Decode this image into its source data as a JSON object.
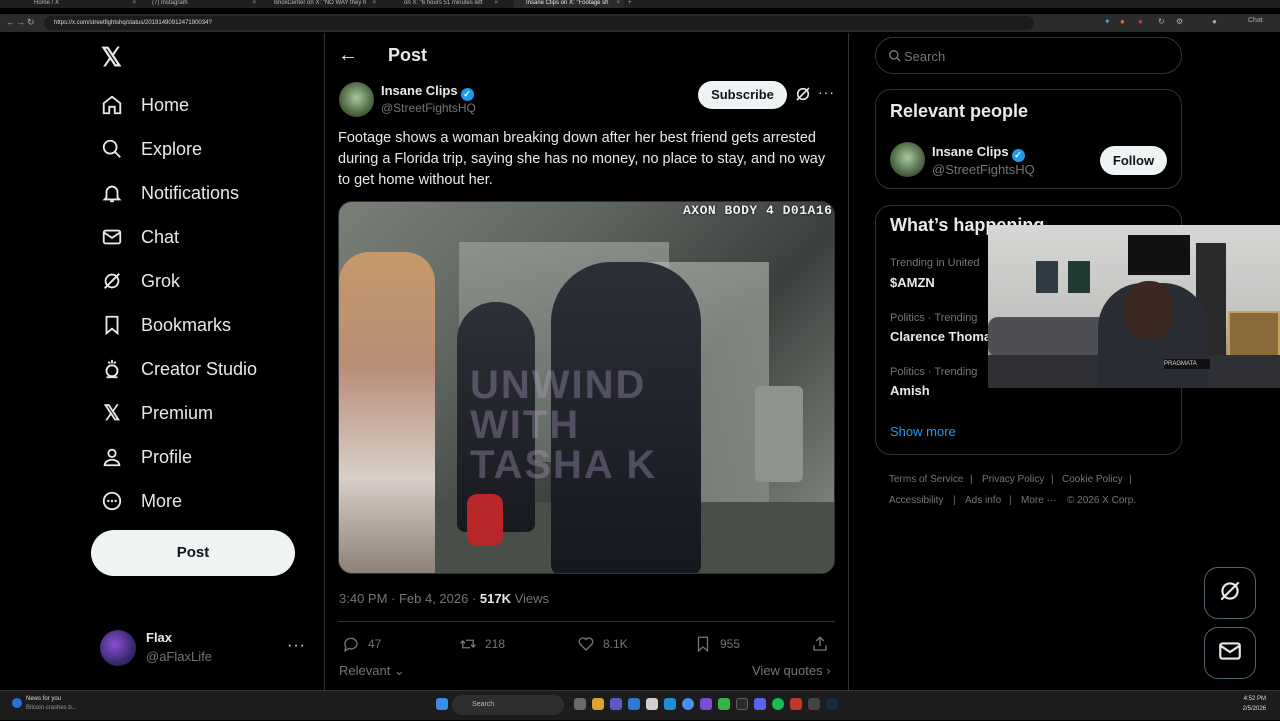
{
  "browser": {
    "tabs": [
      {
        "label": "Home / X",
        "active": false
      },
      {
        "label": "(7) Instagram",
        "active": false
      },
      {
        "label": "BrickCenter on X: \"NO WAY they h",
        "active": false
      },
      {
        "label": "on X: \"6 hours 51 minutes left",
        "active": false
      },
      {
        "label": "Insane Clips on X: \"Footage sh",
        "active": true
      }
    ],
    "url": "https://x.com/streetfightshq/status/2019149091247190034?",
    "chat_label": "Chat"
  },
  "sidebar": {
    "logo": "𝕏",
    "items": [
      {
        "label": "Home",
        "icon": "home-icon"
      },
      {
        "label": "Explore",
        "icon": "search-icon"
      },
      {
        "label": "Notifications",
        "icon": "bell-icon"
      },
      {
        "label": "Chat",
        "icon": "mail-icon"
      },
      {
        "label": "Grok",
        "icon": "grok-icon"
      },
      {
        "label": "Bookmarks",
        "icon": "bookmark-icon"
      },
      {
        "label": "Creator Studio",
        "icon": "creator-studio-icon"
      },
      {
        "label": "Premium",
        "icon": "x-logo-icon"
      },
      {
        "label": "Profile",
        "icon": "person-icon"
      },
      {
        "label": "More",
        "icon": "more-circle-icon"
      }
    ],
    "post_button": "Post",
    "account": {
      "name": "Flax",
      "handle": "@aFlaxLife",
      "more": "···"
    }
  },
  "post": {
    "header_title": "Post",
    "author_name": "Insane Clips",
    "author_handle": "@StreetFightsHQ",
    "subscribe_label": "Subscribe",
    "text": "Footage shows a woman breaking down after her best friend gets arrested during a Florida trip, saying she has no money, no place to stay, and no way to get home without her.",
    "video_overlay": "AXON BODY 4 D01A16",
    "video_watermark": "UNWIND WITH TASHA K",
    "time": "3:40 PM · Feb 4, 2026 · ",
    "views_count": "517K",
    "views_label": " Views",
    "actions": {
      "replies": "47",
      "reposts": "218",
      "likes": "8.1K",
      "bookmarks": "955"
    },
    "relevant_label": "Relevant",
    "view_quotes_label": "View quotes"
  },
  "right": {
    "search_placeholder": "Search",
    "relevant_people_title": "Relevant people",
    "relevant_person": {
      "name": "Insane Clips",
      "handle": "@StreetFightsHQ",
      "follow_label": "Follow"
    },
    "happening_title": "What’s happening",
    "trends": [
      {
        "context": "Trending in United",
        "name": "$AMZN"
      },
      {
        "context": "Politics · Trending",
        "name": "Clarence Thoma"
      },
      {
        "context": "Politics · Trending",
        "name": "Amish"
      }
    ],
    "show_more": "Show more",
    "footer_row1": [
      "Terms of Service",
      "Privacy Policy",
      "Cookie Policy"
    ],
    "footer_row2": [
      "Accessibility",
      "Ads info",
      "More ···",
      "© 2026 X Corp."
    ]
  },
  "webcam": {
    "mic_label": "PRAGMATA"
  },
  "taskbar": {
    "news_title": "News for you",
    "news_sub": "Bitcoin crashes b...",
    "search_placeholder": "Search",
    "time": "4:52 PM",
    "date": "2/5/2026"
  },
  "colors": {
    "accent": "#1d9bf0",
    "background": "#000000",
    "border": "#2f3336",
    "muted": "#71767b",
    "text": "#e7e9ea"
  }
}
